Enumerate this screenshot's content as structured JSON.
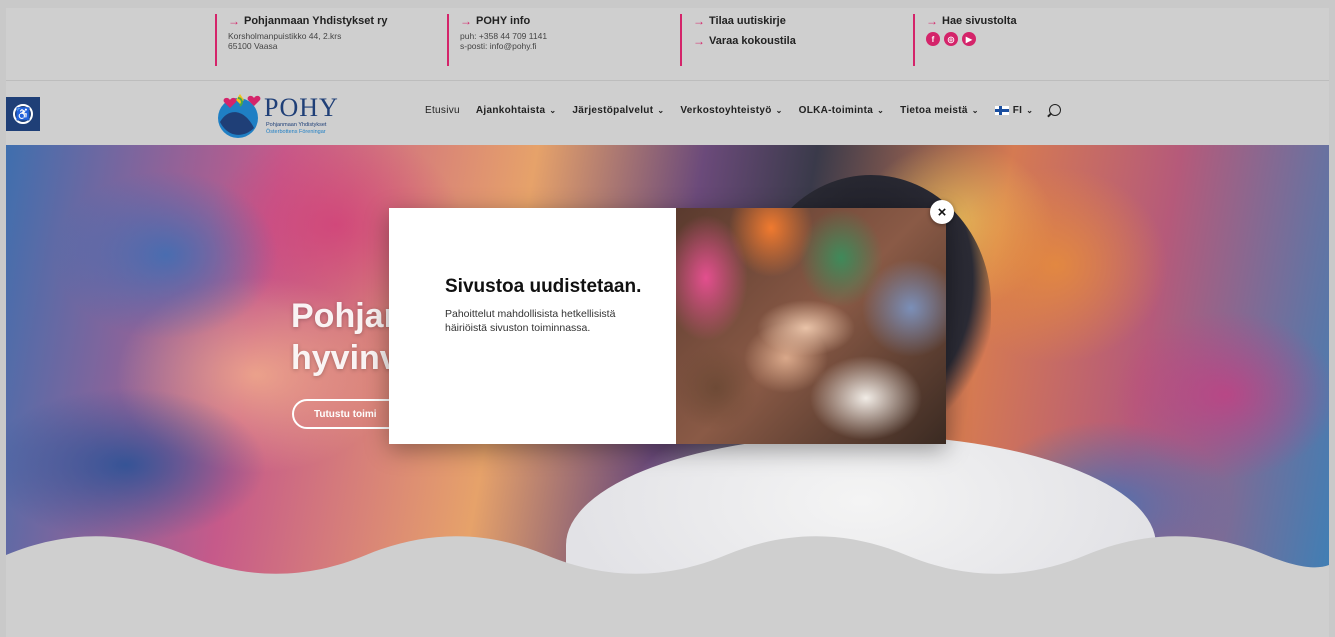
{
  "topbar": {
    "col1": {
      "title": "Pohjanmaan Yhdistykset ry",
      "line1": "Korsholmanpuistikko 44, 2.krs",
      "line2": "65100 Vaasa"
    },
    "col2": {
      "title": "POHY info",
      "line1": "puh: +358 44 709 1141",
      "line2": "s-posti: info@pohy.fi"
    },
    "col3": {
      "link1": "Tilaa uutiskirje",
      "link2": "Varaa kokoustila"
    },
    "col4": {
      "title": "Hae sivustolta",
      "social": [
        "f",
        "◎",
        "▶"
      ]
    },
    "arrow": "→",
    "accent": "#d4246a"
  },
  "logo": {
    "name": "POHY",
    "sub1": "Pohjanmaan Yhdistykset",
    "sub2": "Österbottens Föreningar"
  },
  "nav": {
    "items": [
      "Etusivu",
      "Ajankohtaista",
      "Järjestöpalvelut",
      "Verkostoyhteistyö",
      "OLKA-toiminta",
      "Tietoa meistä"
    ],
    "chevron": "⌄",
    "language": "FI"
  },
  "hero": {
    "title_line1": "Pohjan",
    "title_line2": "hyvinv",
    "button": "Tutustu toimi"
  },
  "modal": {
    "title": "Sivustoa uudistetaan.",
    "body": "Pahoittelut mahdollisista hetkellisistä häiriöistä sivuston toiminnassa.",
    "close": "×"
  },
  "accessibility": {
    "icon": "accessibility-icon",
    "glyph": "♿"
  }
}
